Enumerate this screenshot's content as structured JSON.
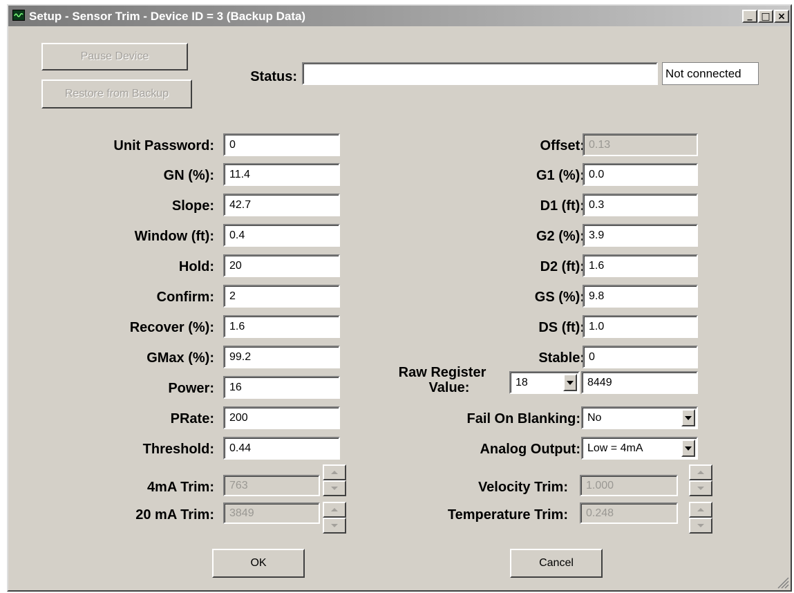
{
  "window": {
    "title": "Setup - Sensor Trim - Device ID = 3 (Backup Data)",
    "controls": {
      "minimize": "_",
      "maximize": "□",
      "close": "×"
    }
  },
  "actions": {
    "pause": "Pause Device",
    "restore": "Restore from Backup",
    "ok": "OK",
    "cancel": "Cancel"
  },
  "status": {
    "label": "Status:",
    "value": "",
    "connection": "Not connected"
  },
  "left_fields": [
    {
      "label": "Unit Password:",
      "value": "0"
    },
    {
      "label": "GN (%):",
      "value": "11.4"
    },
    {
      "label": "Slope:",
      "value": "42.7"
    },
    {
      "label": "Window (ft):",
      "value": "0.4"
    },
    {
      "label": "Hold:",
      "value": "20"
    },
    {
      "label": "Confirm:",
      "value": "2"
    },
    {
      "label": "Recover (%):",
      "value": "1.6"
    },
    {
      "label": "GMax (%):",
      "value": "99.2"
    },
    {
      "label": "Power:",
      "value": "16"
    },
    {
      "label": "PRate:",
      "value": "200"
    },
    {
      "label": "Threshold:",
      "value": "0.44"
    }
  ],
  "right_fields": [
    {
      "label": "Offset:",
      "value": "0.13"
    },
    {
      "label": "G1 (%):",
      "value": "0.0"
    },
    {
      "label": "D1 (ft):",
      "value": "0.3"
    },
    {
      "label": "G2 (%):",
      "value": "3.9"
    },
    {
      "label": "D2 (ft):",
      "value": "1.6"
    },
    {
      "label": "GS (%):",
      "value": "9.8"
    },
    {
      "label": "DS (ft):",
      "value": "1.0"
    },
    {
      "label": "Stable:",
      "value": "0"
    }
  ],
  "raw_register": {
    "label_line1": "Raw Register",
    "label_line2": "Value:",
    "register": "18",
    "value": "8449"
  },
  "fail_on_blanking": {
    "label": "Fail On Blanking:",
    "value": "No"
  },
  "analog_output": {
    "label": "Analog Output:",
    "value": "Low = 4mA"
  },
  "trims": {
    "ma4": {
      "label": "4mA Trim:",
      "value": "763"
    },
    "ma20": {
      "label": "20 mA Trim:",
      "value": "3849"
    },
    "velocity": {
      "label": "Velocity Trim:",
      "value": "1.000"
    },
    "temperature": {
      "label": "Temperature Trim:",
      "value": "0.248"
    }
  },
  "colors": {
    "dialog_bg": "#d4d0c8",
    "title_gradient_start": "#7a7a7a",
    "title_gradient_end": "#c8c8c8",
    "disabled_text": "#a4a19c"
  }
}
